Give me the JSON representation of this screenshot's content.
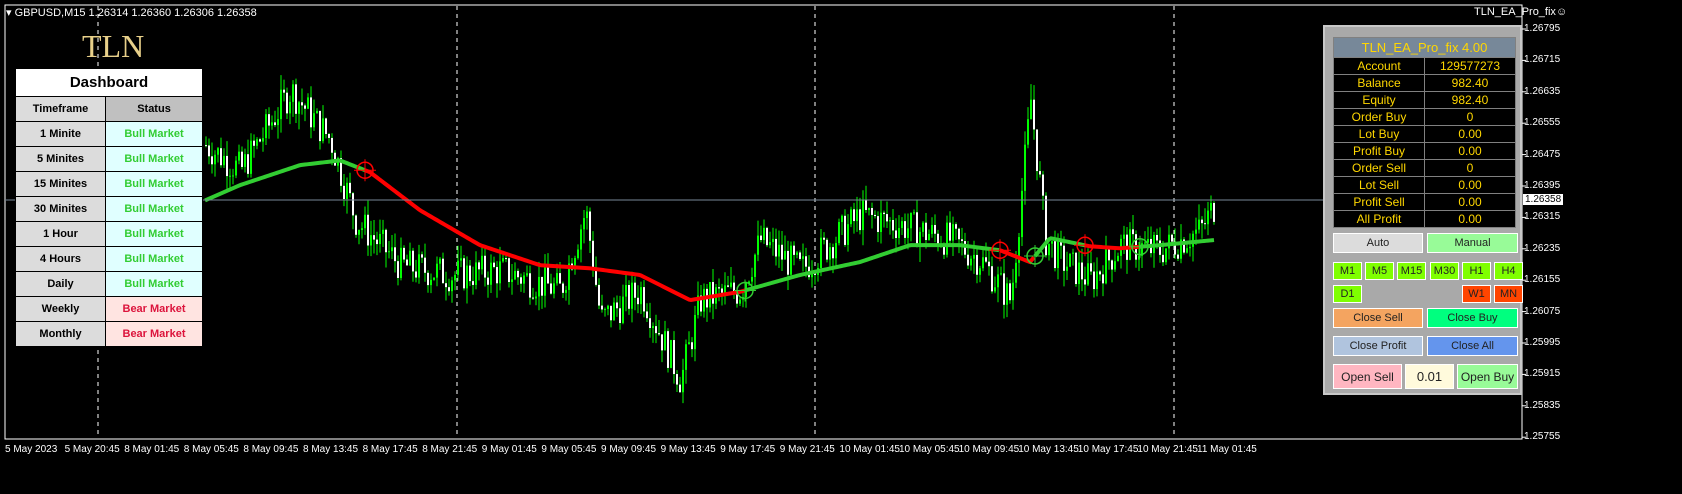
{
  "header": {
    "symbol_line": "GBPUSD,M15  1.26314 1.26360 1.26306 1.26358",
    "ea_name": "TLN_EA_Pro_fix"
  },
  "logo": "TLN",
  "dashboard": {
    "title": "Dashboard",
    "col_timeframe": "Timeframe",
    "col_status": "Status",
    "rows": [
      {
        "tf": "1 Minite",
        "status": "Bull Market",
        "type": "bull"
      },
      {
        "tf": "5 Minites",
        "status": "Bull Market",
        "type": "bull"
      },
      {
        "tf": "15 Minites",
        "status": "Bull Market",
        "type": "bull"
      },
      {
        "tf": "30 Minites",
        "status": "Bull Market",
        "type": "bull"
      },
      {
        "tf": "1 Hour",
        "status": "Bull Market",
        "type": "bull"
      },
      {
        "tf": "4 Hours",
        "status": "Bull Market",
        "type": "bull"
      },
      {
        "tf": "Daily",
        "status": "Bull Market",
        "type": "bull"
      },
      {
        "tf": "Weekly",
        "status": "Bear Market",
        "type": "bear"
      },
      {
        "tf": "Monthly",
        "status": "Bear Market",
        "type": "bear"
      }
    ]
  },
  "panel": {
    "title": "TLN_EA_Pro_fix 4.00",
    "rows": [
      [
        "Account",
        "129577273"
      ],
      [
        "Balance",
        "982.40"
      ],
      [
        "Equity",
        "982.40"
      ],
      [
        "Order Buy",
        "0"
      ],
      [
        "Lot Buy",
        "0.00"
      ],
      [
        "Profit Buy",
        "0.00"
      ],
      [
        "Order Sell",
        "0"
      ],
      [
        "Lot Sell",
        "0.00"
      ],
      [
        "Profit Sell",
        "0.00"
      ],
      [
        "All Profit",
        "0.00"
      ]
    ],
    "auto": "Auto",
    "manual": "Manual",
    "tf_buttons": [
      {
        "l": "M1",
        "c": "#7fff00"
      },
      {
        "l": "M5",
        "c": "#7fff00"
      },
      {
        "l": "M15",
        "c": "#7fff00"
      },
      {
        "l": "M30",
        "c": "#7fff00"
      },
      {
        "l": "H1",
        "c": "#7fff00"
      },
      {
        "l": "H4",
        "c": "#7fff00"
      },
      {
        "l": "D1",
        "c": "#7fff00"
      },
      {
        "l": "W1",
        "c": "#ff4500"
      },
      {
        "l": "MN",
        "c": "#ff4500"
      }
    ],
    "close_sell": "Close Sell",
    "close_buy": "Close Buy",
    "close_profit": "Close Profit",
    "close_all": "Close All",
    "open_sell": "Open Sell",
    "lot": "0.01",
    "open_buy": "Open Buy"
  },
  "price_axis": [
    "1.26795",
    "1.26715",
    "1.26635",
    "1.26555",
    "1.26475",
    "1.26395",
    "1.26315",
    "1.26235",
    "1.26155",
    "1.26075",
    "1.25995",
    "1.25915",
    "1.25835",
    "1.25755"
  ],
  "current_price": "1.26358",
  "time_axis": [
    "5 May 2023",
    "5 May 20:45",
    "8 May 01:45",
    "8 May 05:45",
    "8 May 09:45",
    "8 May 13:45",
    "8 May 17:45",
    "8 May 21:45",
    "9 May 01:45",
    "9 May 05:45",
    "9 May 09:45",
    "9 May 13:45",
    "9 May 17:45",
    "9 May 21:45",
    "10 May 01:45",
    "10 May 05:45",
    "10 May 09:45",
    "10 May 13:45",
    "10 May 17:45",
    "10 May 21:45",
    "11 May 01:45"
  ],
  "chart_data": {
    "type": "candlestick",
    "price_range": [
      1.25755,
      1.26795
    ],
    "close_path": [
      [
        0,
        1.26499
      ],
      [
        35,
        1.26435
      ],
      [
        85,
        1.26639
      ],
      [
        125,
        1.26512
      ],
      [
        150,
        1.26308
      ],
      [
        195,
        1.26193
      ],
      [
        245,
        1.26168
      ],
      [
        295,
        1.2618
      ],
      [
        355,
        1.26129
      ],
      [
        380,
        1.26333
      ],
      [
        395,
        1.26053
      ],
      [
        435,
        1.26129
      ],
      [
        475,
        1.259
      ],
      [
        495,
        1.26104
      ],
      [
        535,
        1.26129
      ],
      [
        555,
        1.26257
      ],
      [
        595,
        1.2618
      ],
      [
        655,
        1.26321
      ],
      [
        695,
        1.26295
      ],
      [
        745,
        1.26257
      ],
      [
        775,
        1.26206
      ],
      [
        805,
        1.26104
      ],
      [
        825,
        1.26614
      ],
      [
        840,
        1.26257
      ],
      [
        855,
        1.26206
      ],
      [
        885,
        1.26155
      ],
      [
        915,
        1.26244
      ],
      [
        955,
        1.26231
      ],
      [
        995,
        1.26282
      ],
      [
        1009,
        1.26346
      ]
    ],
    "ma_path": [
      [
        0,
        1.26358
      ],
      [
        35,
        1.26397
      ],
      [
        95,
        1.26448
      ],
      [
        135,
        1.2646
      ],
      [
        165,
        1.2643
      ],
      [
        215,
        1.26333
      ],
      [
        275,
        1.26244
      ],
      [
        335,
        1.26193
      ],
      [
        385,
        1.26185
      ],
      [
        435,
        1.26168
      ],
      [
        485,
        1.26104
      ],
      [
        535,
        1.26125
      ],
      [
        595,
        1.26168
      ],
      [
        655,
        1.26201
      ],
      [
        705,
        1.26244
      ],
      [
        755,
        1.26244
      ],
      [
        795,
        1.26231
      ],
      [
        825,
        1.26201
      ],
      [
        845,
        1.26262
      ],
      [
        885,
        1.26241
      ],
      [
        915,
        1.26236
      ],
      [
        955,
        1.26244
      ],
      [
        1009,
        1.26257
      ]
    ],
    "ma_colors": [
      [
        0,
        160,
        "#32cd32"
      ],
      [
        160,
        540,
        "#ff0000"
      ],
      [
        540,
        795,
        "#32cd32"
      ],
      [
        795,
        830,
        "#ff0000"
      ],
      [
        830,
        880,
        "#32cd32"
      ],
      [
        880,
        935,
        "#ff0000"
      ],
      [
        935,
        1009,
        "#32cd32"
      ]
    ]
  }
}
